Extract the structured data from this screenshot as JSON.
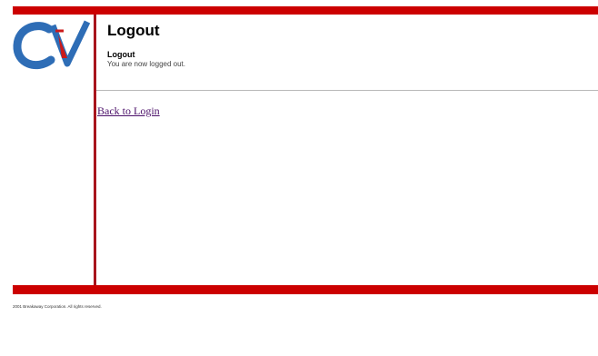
{
  "header": {
    "logo_label": "CV",
    "title": "Logout"
  },
  "message": {
    "heading": "Logout",
    "text": "You are now logged out."
  },
  "links": {
    "back_to_login": "Back to Login"
  },
  "footer": {
    "copyright": "2001 Breakaway Corporation. All rights reserved."
  },
  "colors": {
    "brand_red": "#cc0000",
    "rule_red": "#a8141c",
    "logo_blue": "#2e6db6",
    "link_visited": "#4b1069"
  }
}
